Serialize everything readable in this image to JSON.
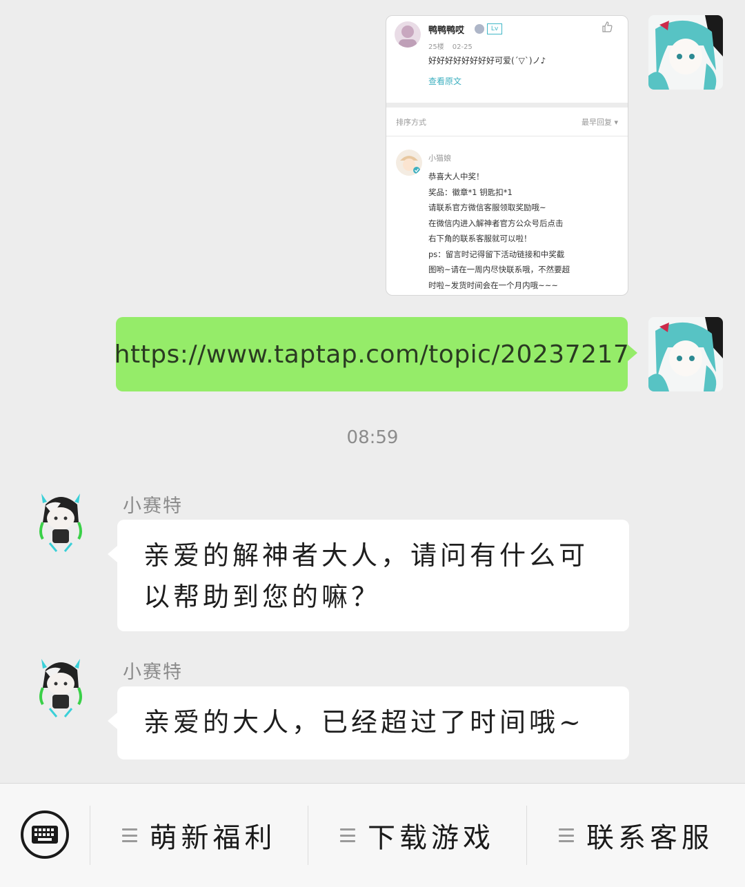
{
  "chat": {
    "shared_screenshot": {
      "user_name": "鸭鸭鸭哎",
      "level_badge": "Lv",
      "floor": "25楼",
      "date": "02-25",
      "comment": "好好好好好好好好可爱(´▽`)ノ♪",
      "view_original": "查看原文",
      "sort_label": "排序方式",
      "sort_value": "最早回复 ▾",
      "reply_name": "小猫娘",
      "reply_lines": [
        "恭喜大人中奖！",
        "奖品：徽章*1 钥匙扣*1",
        "请联系官方微信客服领取奖励哦~",
        "在微信内进入解神者官方公众号后点击",
        "右下角的联系客服就可以啦！",
        "ps：留言时记得留下活动链接和中奖截",
        "图哟~请在一周内尽快联系哦，不然要超",
        "时啦~发货时间会在一个月内哦~~~"
      ]
    },
    "link_message": "https://www.taptap.com/topic/20237217",
    "timestamp": "08:59",
    "messages": [
      {
        "sender": "小赛特",
        "text": "亲爱的解神者大人，请问有什么可以帮助到您的嘛？"
      },
      {
        "sender": "小赛特",
        "text": "亲爱的大人，已经超过了时间哦~"
      }
    ]
  },
  "bottom_menu": {
    "items": [
      {
        "label": "萌新福利"
      },
      {
        "label": "下载游戏"
      },
      {
        "label": "联系客服"
      }
    ]
  },
  "colors": {
    "background": "#ededed",
    "self_bubble": "#95ec69",
    "other_bubble": "#ffffff",
    "link_accent": "#3fb0c0"
  }
}
